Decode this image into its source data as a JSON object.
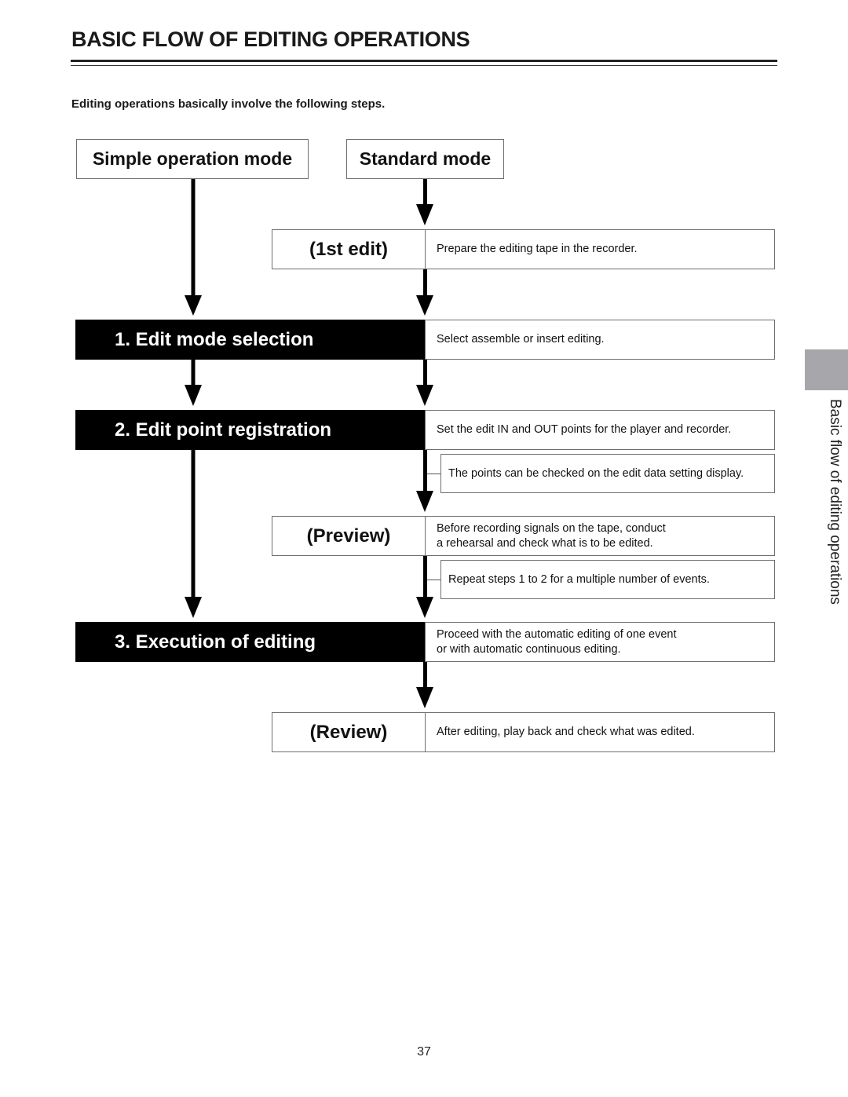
{
  "header": {
    "title": "BASIC FLOW OF EDITING OPERATIONS",
    "intro": "Editing operations basically involve the following steps."
  },
  "modes": {
    "simple": "Simple operation mode",
    "standard": "Standard mode"
  },
  "flow": {
    "first_edit": {
      "label": "(1st edit)",
      "description": [
        "Prepare the editing tape in the recorder."
      ]
    },
    "step1": {
      "label": "1. Edit mode selection",
      "description": [
        "Select assemble or insert editing."
      ]
    },
    "step2": {
      "label": "2. Edit point registration",
      "description": [
        "Set the edit IN and OUT points for the player and recorder."
      ],
      "note": "The points can be checked on the edit data setting display."
    },
    "preview": {
      "label": "(Preview)",
      "description": [
        "Before recording signals on the tape, conduct",
        "a rehearsal and check what is to be edited."
      ],
      "note": "Repeat steps 1 to 2 for a multiple number of events."
    },
    "step3": {
      "label": "3. Execution of editing",
      "description": [
        "Proceed with the automatic editing of one event",
        "or with automatic continuous editing."
      ]
    },
    "review": {
      "label": "(Review)",
      "description": [
        "After editing, play back and check what was edited."
      ]
    }
  },
  "side": {
    "section_label": "Basic flow of editing operations",
    "tab_color": "#a7a7ab"
  },
  "footer": {
    "page_number": "37"
  }
}
